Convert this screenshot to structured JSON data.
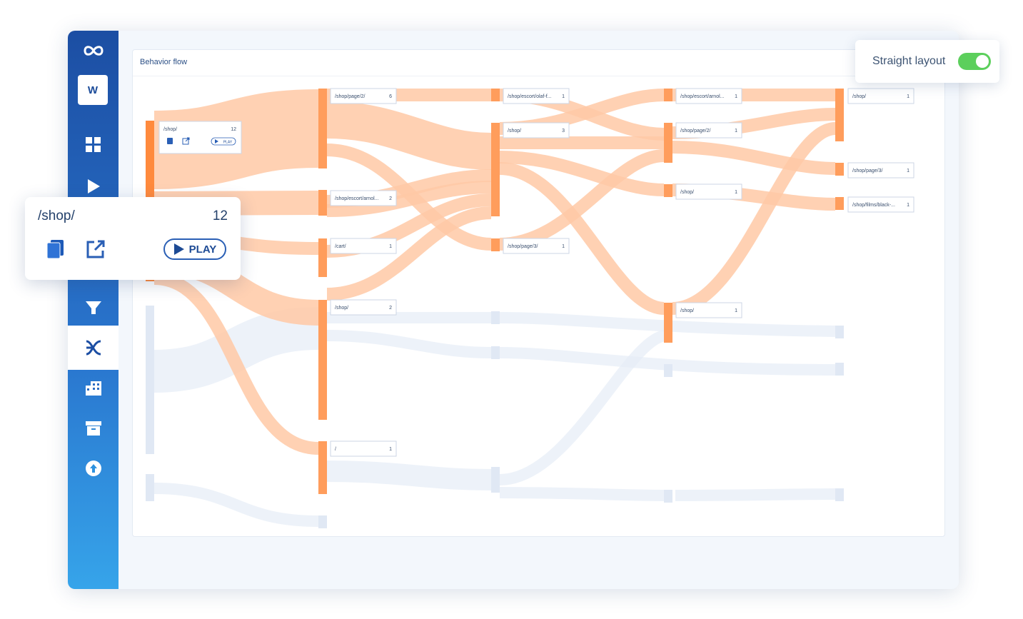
{
  "sidebar": {
    "workspace_initial": "W",
    "icons": [
      "infinity-logo-icon",
      "grid-icon",
      "play-icon",
      "funnel-icon",
      "behavior-flow-icon",
      "building-icon",
      "archive-icon",
      "upload-icon"
    ]
  },
  "panel": {
    "title": "Behavior flow"
  },
  "toggle": {
    "label": "Straight layout",
    "on": true,
    "color": "#5ccf5c"
  },
  "popover": {
    "path": "/shop/",
    "count": "12",
    "play_label": "PLAY"
  },
  "start_node": {
    "path": "/shop/",
    "count": "12",
    "play_label": "PLAY"
  },
  "colors": {
    "flow": "#ffc9a6",
    "node": "#ff9d5c",
    "inactive": "#e5ecf6",
    "accent": "#1c4ea3"
  },
  "nodes": [
    {
      "path": "/shop/page/2/",
      "count": "6"
    },
    {
      "path": "/shop/escort/arnol...",
      "count": "2"
    },
    {
      "path": "/cart/",
      "count": "1"
    },
    {
      "path": "/shop/",
      "count": "2"
    },
    {
      "path": "/",
      "count": "1"
    },
    {
      "path": "/shop/escort/olaf-f...",
      "count": "1"
    },
    {
      "path": "/shop/",
      "count": "3"
    },
    {
      "path": "/shop/page/3/",
      "count": "1"
    },
    {
      "path": "/shop/escort/arnol...",
      "count": "1"
    },
    {
      "path": "/shop/page/2/",
      "count": "1"
    },
    {
      "path": "/shop/",
      "count": "1"
    },
    {
      "path": "/shop/",
      "count": "1"
    },
    {
      "path": "/shop/",
      "count": "1"
    },
    {
      "path": "/shop/page/3/",
      "count": "1"
    },
    {
      "path": "/shop/films/black-...",
      "count": "1"
    }
  ]
}
